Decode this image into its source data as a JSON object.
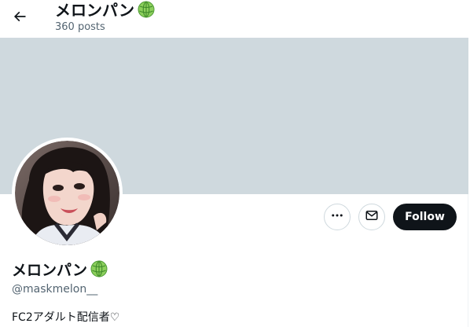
{
  "header": {
    "name": "メロンパン",
    "name_emoji": "melon-emoji",
    "posts": "360 posts",
    "back_icon": "arrow-left-icon"
  },
  "profile": {
    "display_name": "メロンパン",
    "name_emoji": "melon-emoji",
    "handle": "@maskmelon__",
    "bio": "FC2アダルト配信者♡"
  },
  "actions": {
    "more_icon": "more-horizontal-icon",
    "message_icon": "envelope-icon",
    "follow_label": "Follow"
  },
  "colors": {
    "banner": "#cfd9de",
    "follow_bg": "#0f1419",
    "muted_text": "#536471",
    "border": "#cfd9de"
  }
}
